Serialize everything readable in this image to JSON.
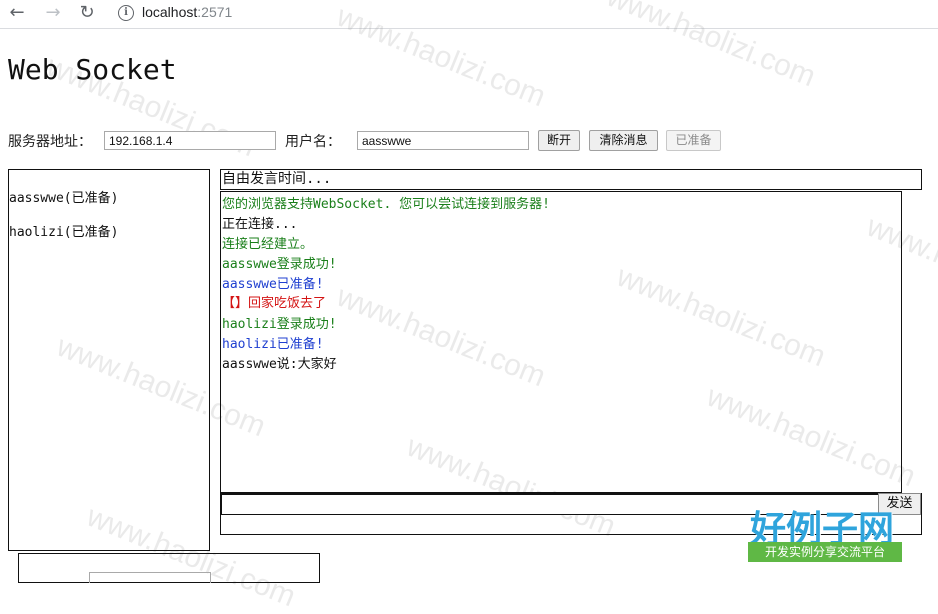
{
  "browser": {
    "host": "localhost",
    "port": ":2571"
  },
  "page": {
    "title": "Web Socket"
  },
  "connection": {
    "server_label": "服务器地址：",
    "server_value": "192.168.1.4",
    "user_label": "用户名：",
    "user_value": "aasswwe",
    "disconnect_label": "断开",
    "clear_label": "清除消息",
    "ready_label": "已准备"
  },
  "users": [
    "aasswwe(已准备)",
    "haolizi(已准备)"
  ],
  "topic": "自由发言时间...",
  "messages": [
    {
      "text": "您的浏览器支持WebSocket. 您可以尝试连接到服务器!",
      "type": "ok"
    },
    {
      "text": "正在连接...",
      "type": "plain"
    },
    {
      "text": "连接已经建立。",
      "type": "ok"
    },
    {
      "text": "aasswwe登录成功!",
      "type": "ok"
    },
    {
      "text": "aasswwe已准备!",
      "type": "info"
    },
    {
      "text": "【】回家吃饭去了",
      "type": "err"
    },
    {
      "text": "haolizi登录成功!",
      "type": "ok"
    },
    {
      "text": "haolizi已准备!",
      "type": "info"
    },
    {
      "text": "aasswwe说:大家好",
      "type": "plain"
    }
  ],
  "send_label": "发送",
  "watermark": {
    "text": "www.haolizi.com",
    "logo_main": "好例子网",
    "logo_sub": "开发实例分享交流平台"
  },
  "colors": {
    "ok": "#1a7f1a",
    "info": "#1f3fd0",
    "err": "#d41414"
  }
}
